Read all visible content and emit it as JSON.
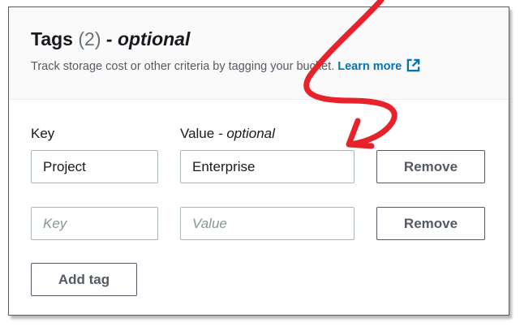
{
  "header": {
    "title": "Tags",
    "count": "(2)",
    "optional_suffix": "- optional",
    "description": "Track storage cost or other criteria by tagging your bucket.",
    "learn_more": "Learn more",
    "learn_more_icon": "external-link-icon"
  },
  "columns": {
    "key_label": "Key",
    "value_label": "Value",
    "value_optional": "- optional"
  },
  "rows": [
    {
      "key_value": "Project",
      "key_placeholder": "Key",
      "value_value": "Enterprise",
      "value_placeholder": "Value",
      "remove_label": "Remove"
    },
    {
      "key_value": "",
      "key_placeholder": "Key",
      "value_value": "",
      "value_placeholder": "Value",
      "remove_label": "Remove"
    }
  ],
  "add_tag_label": "Add tag",
  "colors": {
    "link": "#0073bb",
    "annotation": "#e8222a",
    "border": "#545b64"
  }
}
